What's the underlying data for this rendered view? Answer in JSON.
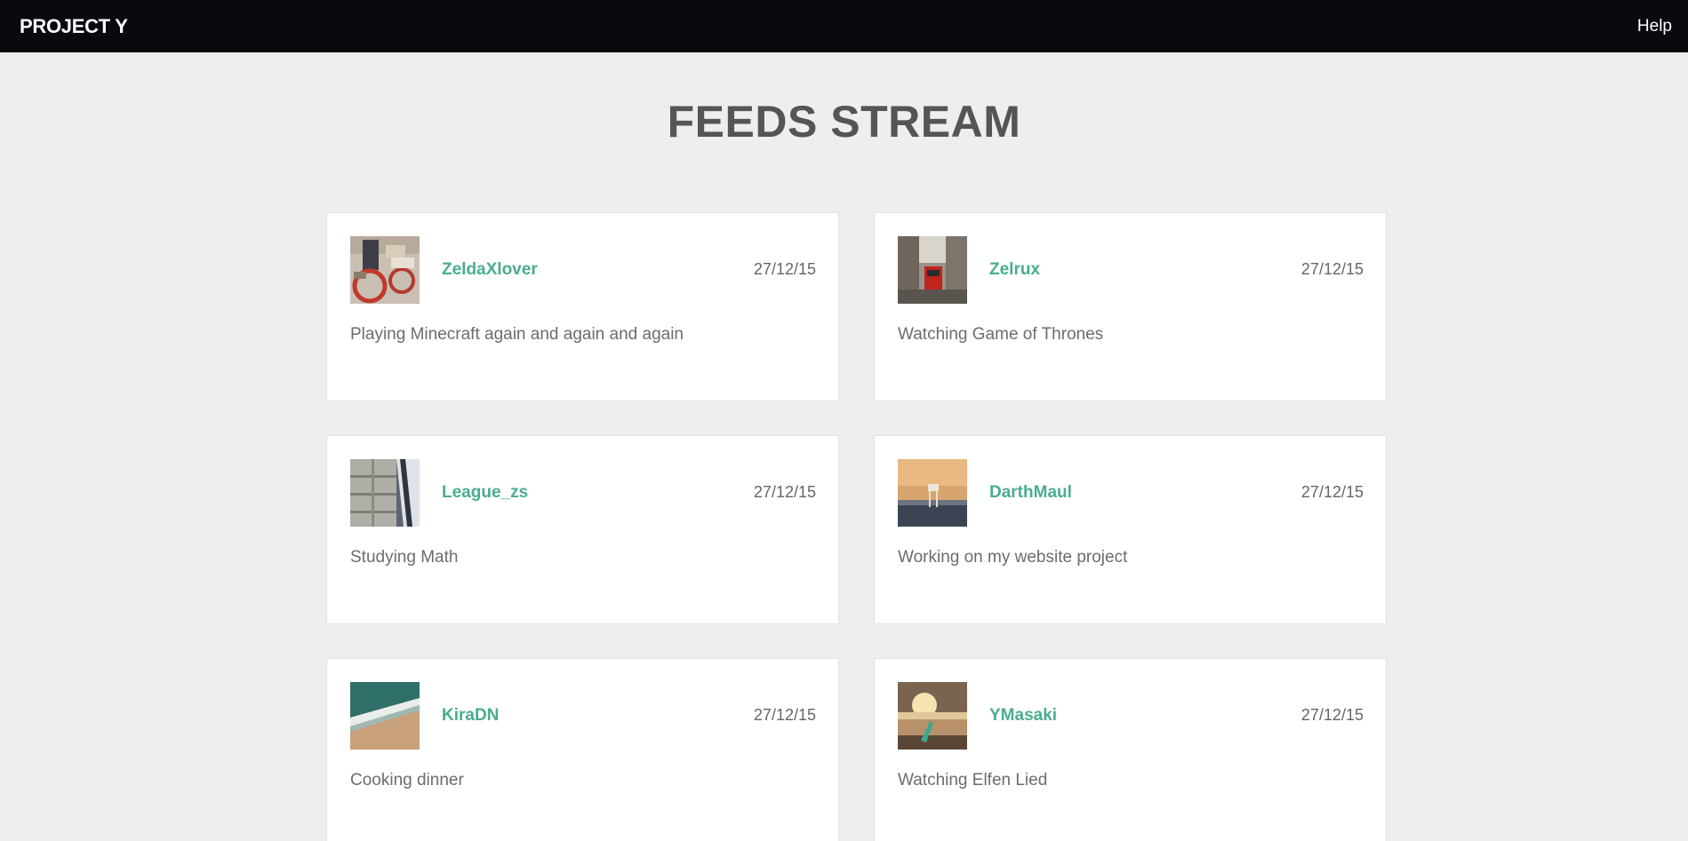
{
  "navbar": {
    "brand": "PROJECT Y",
    "help": "Help"
  },
  "page": {
    "title": "FEEDS STREAM"
  },
  "feeds": [
    {
      "username": "ZeldaXlover",
      "date": "27/12/15",
      "status": "Playing Minecraft again and again and again",
      "avatar": "toy-bike-photo"
    },
    {
      "username": "Zelrux",
      "date": "27/12/15",
      "status": "Watching Game of Thrones",
      "avatar": "red-tram-street-photo"
    },
    {
      "username": "League_zs",
      "date": "27/12/15",
      "status": "Studying Math",
      "avatar": "grain-silo-photo"
    },
    {
      "username": "DarthMaul",
      "date": "27/12/15",
      "status": "Working on my website project",
      "avatar": "lifeguard-tower-photo"
    },
    {
      "username": "KiraDN",
      "date": "27/12/15",
      "status": "Cooking dinner",
      "avatar": "beach-waves-photo"
    },
    {
      "username": "YMasaki",
      "date": "27/12/15",
      "status": "Watching Elfen Lied",
      "avatar": "sunset-surfboard-photo"
    }
  ]
}
